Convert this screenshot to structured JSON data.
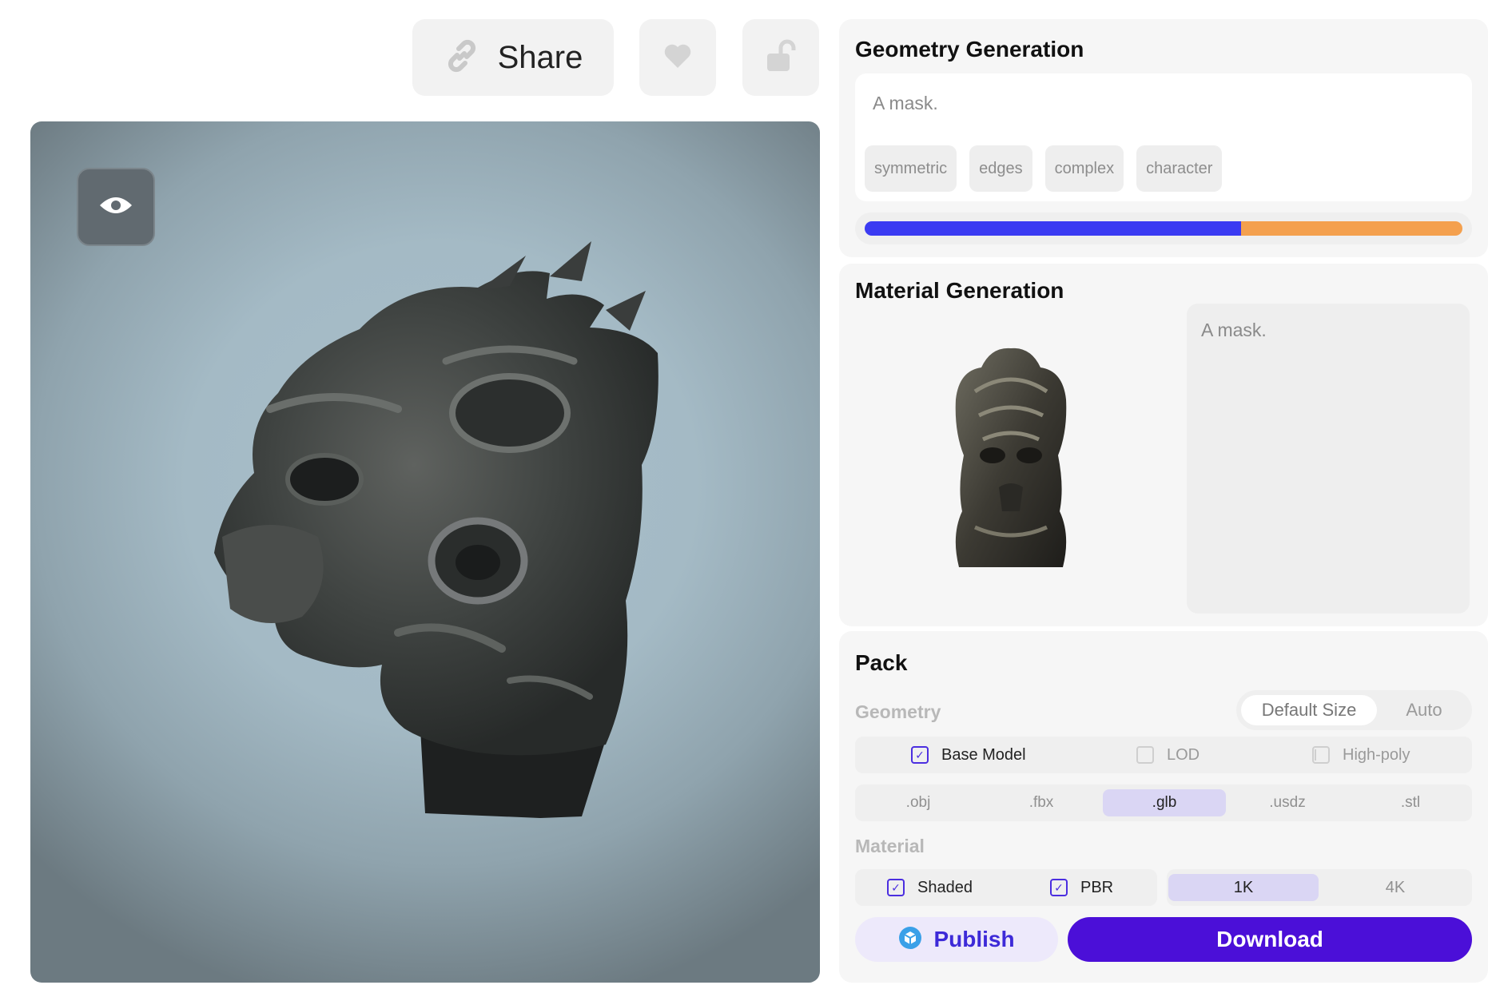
{
  "toolbar": {
    "share_label": "Share",
    "share_icon": "link-icon",
    "like_icon": "heart-icon",
    "lock_icon": "unlock-icon"
  },
  "viewer": {
    "toggle_icon": "eye-icon",
    "background_color": "#a4bac5"
  },
  "geometry_generation": {
    "title": "Geometry Generation",
    "prompt": "A mask.",
    "tags": [
      "symmetric",
      "edges",
      "complex",
      "character"
    ],
    "progress": {
      "completed_fraction": 0.63,
      "completed_color": "#3b3bf2",
      "remaining_color": "#f4a04e"
    }
  },
  "material_generation": {
    "title": "Material Generation",
    "prompt": "A mask."
  },
  "pack": {
    "title": "Pack",
    "geometry_label": "Geometry",
    "size_options": [
      {
        "label": "Default Size",
        "selected": true
      },
      {
        "label": "Auto",
        "selected": false
      }
    ],
    "geometry_checks": [
      {
        "label": "Base Model",
        "checked": true
      },
      {
        "label": "LOD",
        "checked": false
      },
      {
        "label": "High-poly",
        "checked": false
      }
    ],
    "formats": [
      {
        "label": ".obj",
        "selected": false
      },
      {
        "label": ".fbx",
        "selected": false
      },
      {
        "label": ".glb",
        "selected": true
      },
      {
        "label": ".usdz",
        "selected": false
      },
      {
        "label": ".stl",
        "selected": false
      }
    ],
    "material_label": "Material",
    "material_checks": [
      {
        "label": "Shaded",
        "checked": true
      },
      {
        "label": "PBR",
        "checked": true
      }
    ],
    "resolutions": [
      {
        "label": "1K",
        "selected": true
      },
      {
        "label": "4K",
        "selected": false
      }
    ],
    "publish_label": "Publish",
    "publish_icon": "cube-badge-icon",
    "download_label": "Download",
    "accent_color": "#4b0fd8"
  }
}
